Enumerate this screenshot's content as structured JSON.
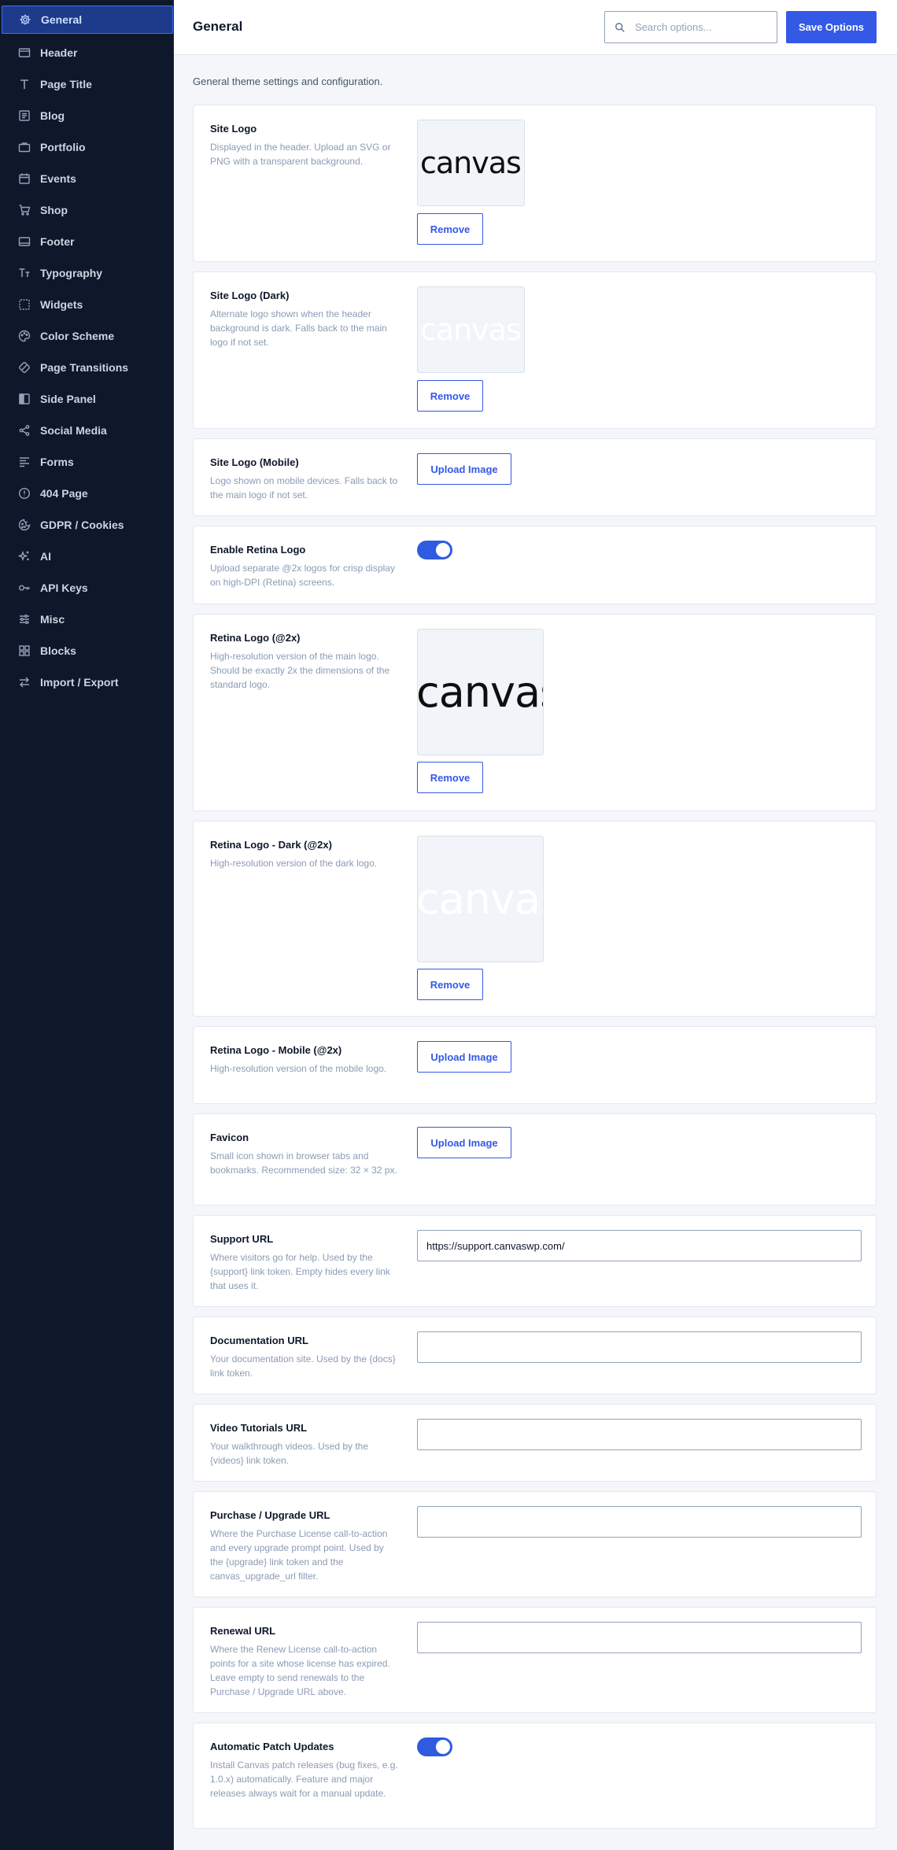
{
  "sidebar": {
    "items": [
      {
        "label": "General",
        "icon": "gear-icon"
      },
      {
        "label": "Header",
        "icon": "window-icon"
      },
      {
        "label": "Page Title",
        "icon": "text-t-icon"
      },
      {
        "label": "Blog",
        "icon": "article-icon"
      },
      {
        "label": "Portfolio",
        "icon": "briefcase-icon"
      },
      {
        "label": "Events",
        "icon": "calendar-icon"
      },
      {
        "label": "Shop",
        "icon": "cart-icon"
      },
      {
        "label": "Footer",
        "icon": "footer-icon"
      },
      {
        "label": "Typography",
        "icon": "typography-icon"
      },
      {
        "label": "Widgets",
        "icon": "widgets-icon"
      },
      {
        "label": "Color Scheme",
        "icon": "palette-icon"
      },
      {
        "label": "Page Transitions",
        "icon": "transitions-icon"
      },
      {
        "label": "Side Panel",
        "icon": "side-panel-icon"
      },
      {
        "label": "Social Media",
        "icon": "share-icon"
      },
      {
        "label": "Forms",
        "icon": "forms-icon"
      },
      {
        "label": "404 Page",
        "icon": "alert-circle-icon"
      },
      {
        "label": "GDPR / Cookies",
        "icon": "cookie-icon"
      },
      {
        "label": "AI",
        "icon": "sparkle-icon"
      },
      {
        "label": "API Keys",
        "icon": "key-icon"
      },
      {
        "label": "Misc",
        "icon": "sliders-icon"
      },
      {
        "label": "Blocks",
        "icon": "blocks-icon"
      },
      {
        "label": "Import / Export",
        "icon": "arrows-swap-icon"
      }
    ]
  },
  "header": {
    "title": "General",
    "search_placeholder": "Search options...",
    "save_label": "Save Options"
  },
  "main": {
    "intro": "General theme settings and configuration.",
    "logo_text": "canvas",
    "settings": {
      "site_logo": {
        "label": "Site Logo",
        "desc": "Displayed in the header. Upload an SVG or PNG with a transparent background.",
        "button": "Remove"
      },
      "site_logo_dark": {
        "label": "Site Logo (Dark)",
        "desc": "Alternate logo shown when the header background is dark. Falls back to the main logo if not set.",
        "button": "Remove"
      },
      "site_logo_mobile": {
        "label": "Site Logo (Mobile)",
        "desc": "Logo shown on mobile devices. Falls back to the main logo if not set.",
        "button": "Upload Image"
      },
      "enable_retina": {
        "label": "Enable Retina Logo",
        "desc": "Upload separate @2x logos for crisp display on high-DPI (Retina) screens.",
        "enabled": true
      },
      "retina_logo": {
        "label": "Retina Logo (@2x)",
        "desc": "High-resolution version of the main logo. Should be exactly 2x the dimensions of the standard logo.",
        "button": "Remove"
      },
      "retina_logo_dark": {
        "label": "Retina Logo - Dark (@2x)",
        "desc": "High-resolution version of the dark logo.",
        "button": "Remove"
      },
      "retina_logo_mobile": {
        "label": "Retina Logo - Mobile (@2x)",
        "desc": "High-resolution version of the mobile logo.",
        "button": "Upload Image"
      },
      "favicon": {
        "label": "Favicon",
        "desc": "Small icon shown in browser tabs and bookmarks. Recommended size: 32 × 32 px.",
        "button": "Upload Image"
      },
      "support_url": {
        "label": "Support URL",
        "desc": "Where visitors go for help. Used by the {support} link token. Empty hides every link that uses it.",
        "value": "https://support.canvaswp.com/"
      },
      "documentation_url": {
        "label": "Documentation URL",
        "desc": "Your documentation site. Used by the {docs} link token.",
        "value": ""
      },
      "video_tutorials_url": {
        "label": "Video Tutorials URL",
        "desc": "Your walkthrough videos. Used by the {videos} link token.",
        "value": ""
      },
      "purchase_url": {
        "label": "Purchase / Upgrade URL",
        "desc": "Where the Purchase License call-to-action and every upgrade prompt point. Used by the {upgrade} link token and the canvas_upgrade_url filter.",
        "value": ""
      },
      "renewal_url": {
        "label": "Renewal URL",
        "desc": "Where the Renew License call-to-action points for a site whose license has expired. Leave empty to send renewals to the Purchase / Upgrade URL above.",
        "value": ""
      },
      "auto_patch": {
        "label": "Automatic Patch Updates",
        "desc": "Install Canvas patch releases (bug fixes, e.g. 1.0.x) automatically. Feature and major releases always wait for a manual update.",
        "enabled": true
      }
    }
  },
  "colors": {
    "sidebar_bg": "#0f172a",
    "active_item_bg": "#1e3a8a",
    "accent": "#3459e6",
    "toggle_on": "#2f5be0"
  }
}
